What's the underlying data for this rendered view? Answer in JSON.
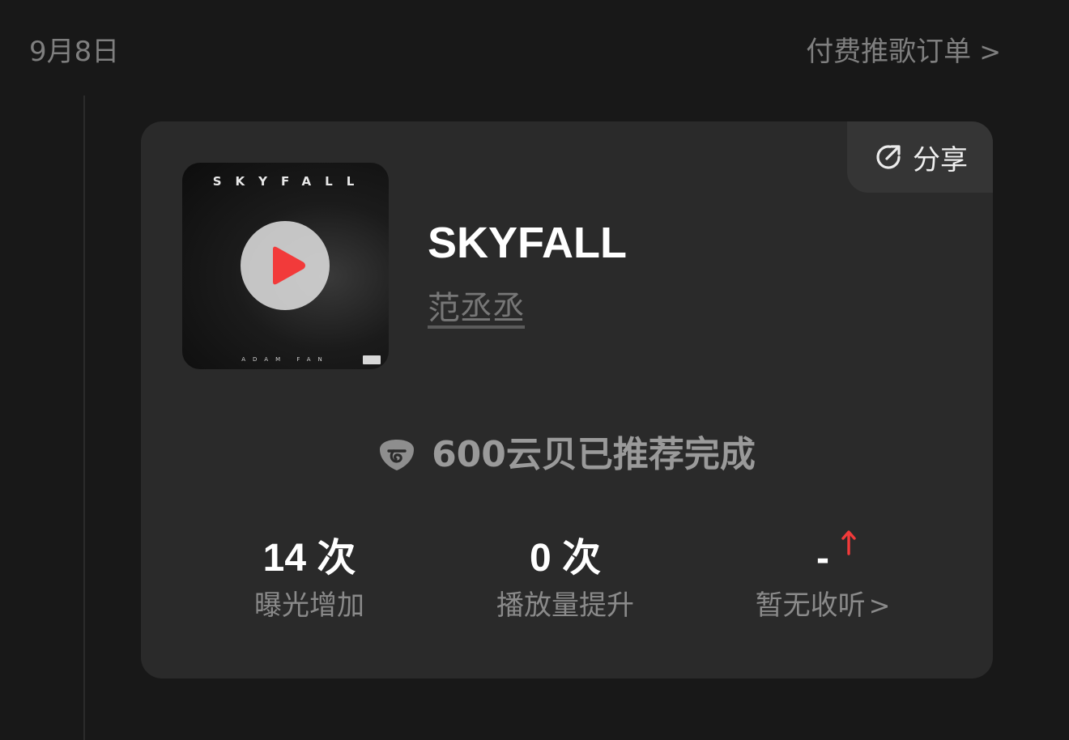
{
  "header": {
    "date": "9月8日",
    "orders_link": "付费推歌订单",
    "orders_chevron": ">"
  },
  "card": {
    "share_label": "分享",
    "cover": {
      "title": "SKYFALL",
      "artist": "ADAM FAN"
    },
    "song_title": "SKYFALL",
    "artist": "范丞丞",
    "status_text": "600云贝已推荐完成",
    "stats": [
      {
        "value": "14 次",
        "label": "曝光增加"
      },
      {
        "value": "0 次",
        "label": "播放量提升"
      },
      {
        "value": "-",
        "label": "暂无收听",
        "chevron": ">"
      }
    ]
  },
  "colors": {
    "background": "#181818",
    "card": "#2a2a2a",
    "accent_red": "#f23a3a",
    "muted_text": "#8a8a8a"
  },
  "icons": {
    "share": "share-arrow-circle-icon",
    "play": "play-icon",
    "coin": "cloud-coin-icon",
    "trend": "up-arrow-icon"
  }
}
